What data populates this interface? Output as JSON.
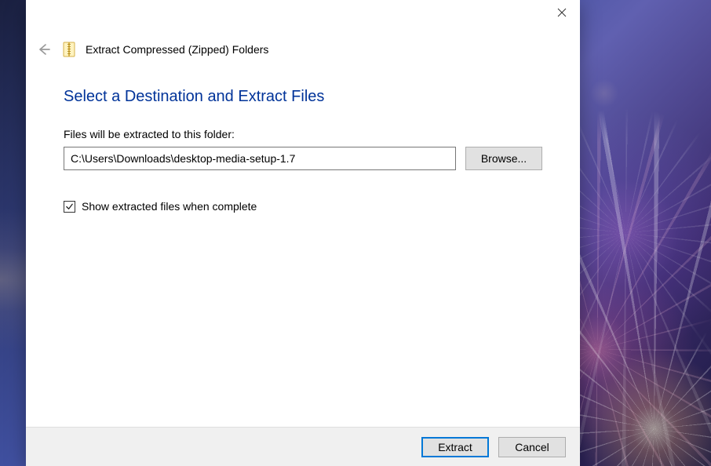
{
  "window": {
    "title": "Extract Compressed (Zipped) Folders"
  },
  "main": {
    "heading": "Select a Destination and Extract Files",
    "path_label": "Files will be extracted to this folder:",
    "path_value": "C:\\Users\\Downloads\\desktop-media-setup-1.7",
    "browse_label": "Browse...",
    "checkbox_label": "Show extracted files when complete",
    "checkbox_checked": true
  },
  "footer": {
    "extract_label": "Extract",
    "cancel_label": "Cancel"
  }
}
